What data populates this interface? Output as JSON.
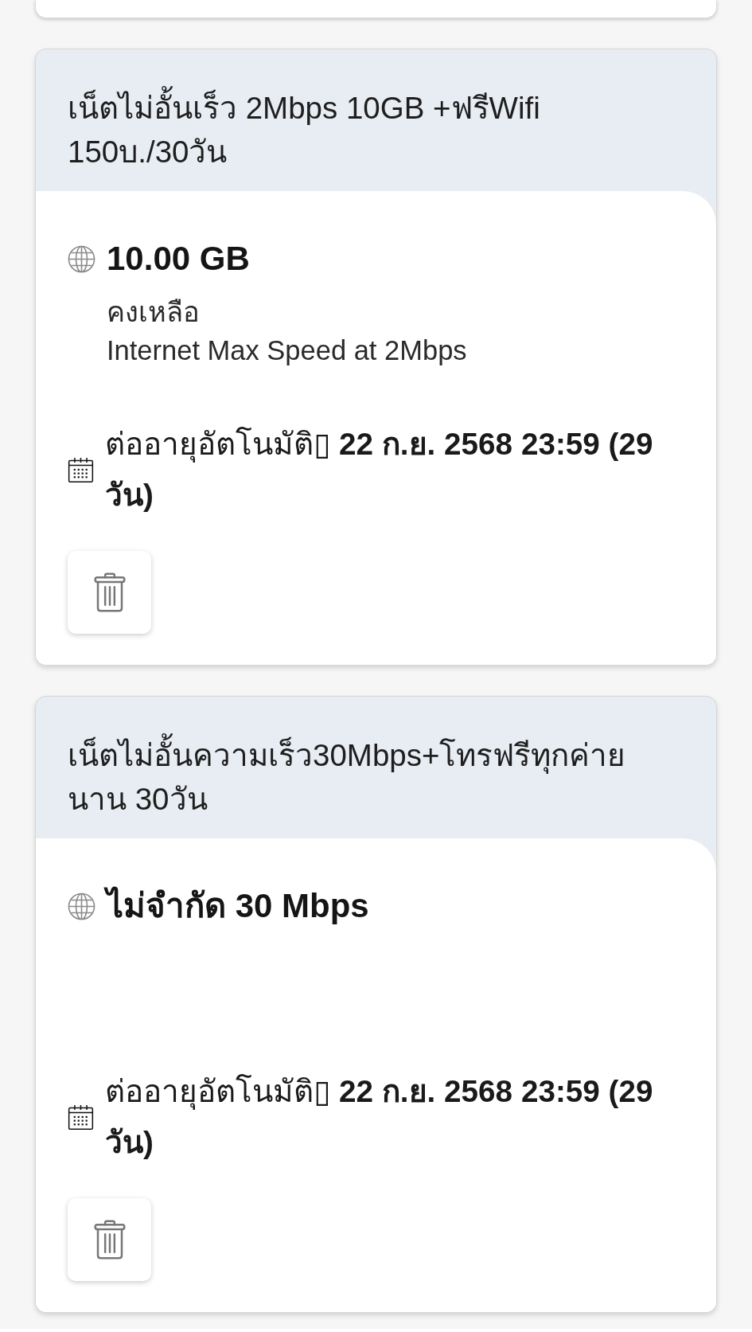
{
  "packages": [
    {
      "title": "เน็ตไม่อั้นเร็ว 2Mbps 10GB +ฟรีWifi 150บ./30วัน",
      "amount": "10.00 GB",
      "details": [
        "คงเหลือ",
        "Internet Max Speed at 2Mbps"
      ],
      "renewal": "ต่ออายุอัตโนมัติ▯ **22 ก.ย. 2568 23:59 (29 วัน)**"
    },
    {
      "title": "เน็ตไม่อั้นความเร็ว30Mbps+โทรฟรีทุกค่าย นาน 30วัน",
      "amount": "ไม่จำกัด 30 Mbps",
      "renewal": "ต่ออายุอัตโนมัติ▯ **22 ก.ย. 2568 23:59 (29 วัน)**"
    }
  ]
}
